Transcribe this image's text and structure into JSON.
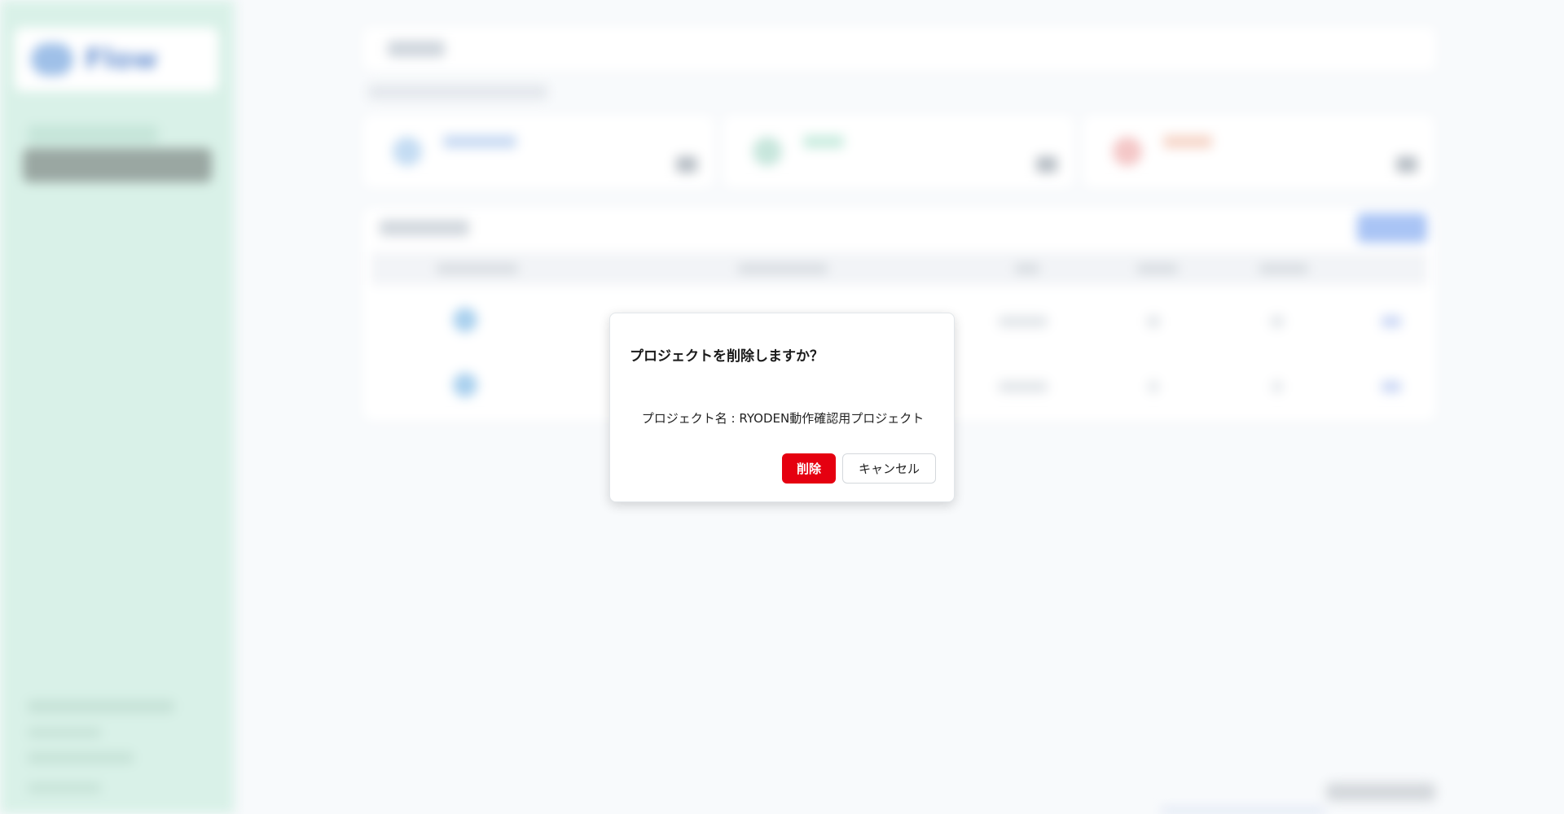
{
  "app": {
    "logo_text": "Flow"
  },
  "dialog": {
    "title": "プロジェクトを削除しますか？",
    "body": "プロジェクト名 : RYODEN動作確認用プロジェクト",
    "delete_label": "削除",
    "cancel_label": "キャンセル"
  },
  "colors": {
    "delete_button": "#e50010",
    "sidebar_bg": "#d9f1e8",
    "page_bg": "#f8fafc"
  }
}
